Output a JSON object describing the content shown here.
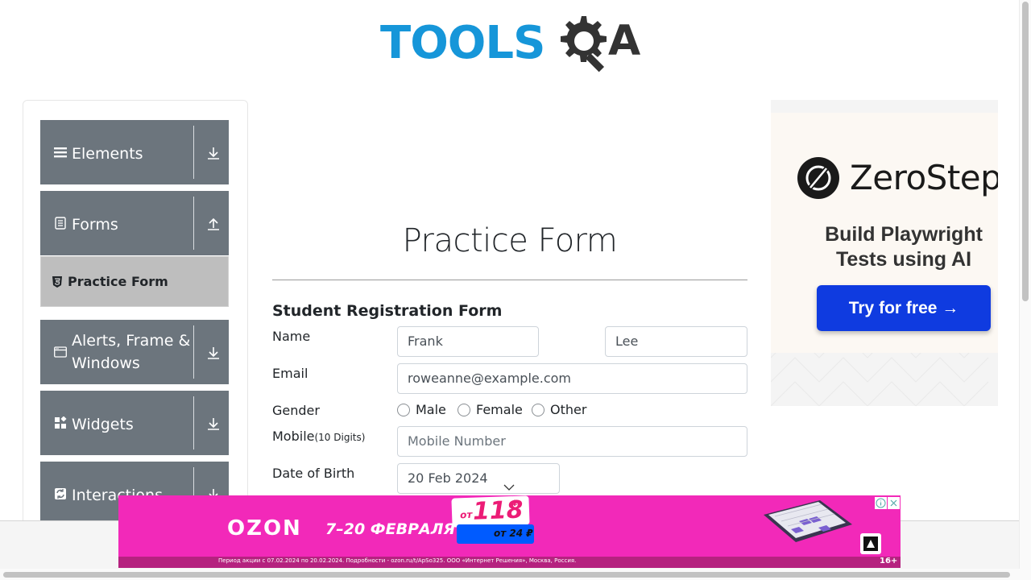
{
  "header": {
    "logo_text": "TOOLS",
    "logo_suffix": "QA",
    "brand_color": "#1696d9"
  },
  "sidebar": {
    "groups": [
      {
        "label": "Elements",
        "icon": "hamburger-icon",
        "arrow": "download-icon"
      },
      {
        "label": "Forms",
        "icon": "document-icon",
        "arrow": "upload-icon"
      },
      {
        "label": "Alerts, Frame & Windows",
        "icon": "window-icon",
        "arrow": "download-icon"
      },
      {
        "label": "Widgets",
        "icon": "widgets-icon",
        "arrow": "download-icon"
      },
      {
        "label": "Interactions",
        "icon": "interactions-icon",
        "arrow": "download-icon"
      }
    ],
    "active_item": {
      "label": "Practice Form",
      "icon": "html5-icon"
    },
    "group_color": "#6c757d",
    "active_color": "#bebebe"
  },
  "main": {
    "title": "Practice Form",
    "form_heading": "Student Registration Form",
    "labels": {
      "name": "Name",
      "email": "Email",
      "gender": "Gender",
      "mobile": "Mobile",
      "mobile_hint": "(10 Digits)",
      "dob": "Date of Birth"
    },
    "fields": {
      "first_name": "Frank",
      "last_name": "Lee",
      "email": "roweanne@example.com",
      "mobile_placeholder": "Mobile Number",
      "dob": "20 Feb 2024"
    },
    "gender_options": [
      "Male",
      "Female",
      "Other"
    ]
  },
  "ad_right": {
    "brand": "ZeroStep",
    "tagline": "Build Playwright Tests using AI",
    "cta": "Try for free →",
    "cta_color": "#0f3be0"
  },
  "ad_bottom": {
    "brand": "OZON",
    "dates": "7–20 ФЕВРАЛЯ",
    "price_from": "от",
    "price": "118",
    "currency": "₽",
    "sub_price": "от 24 ₽",
    "fine_print": "Период акции с 07.02.2024 по 20.02.2024. Подробности - ozon.ru/t/ApSo325. ООО «Интернет Решения», Москва, Россия.",
    "age": "16+",
    "bg_color": "#f229b9"
  }
}
